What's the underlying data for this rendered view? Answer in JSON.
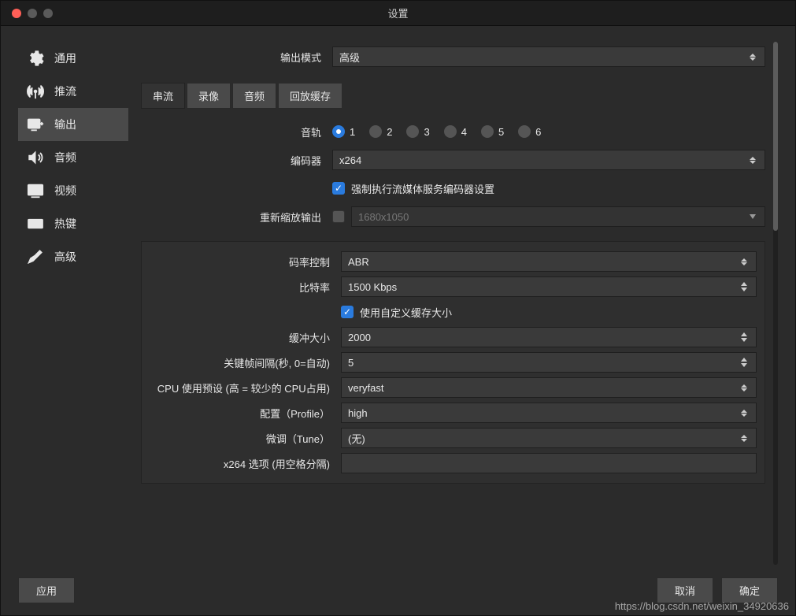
{
  "window": {
    "title": "设置"
  },
  "sidebar": {
    "items": [
      {
        "label": "通用"
      },
      {
        "label": "推流"
      },
      {
        "label": "输出"
      },
      {
        "label": "音频"
      },
      {
        "label": "视频"
      },
      {
        "label": "热键"
      },
      {
        "label": "高级"
      }
    ]
  },
  "output_mode": {
    "label": "输出模式",
    "value": "高级"
  },
  "tabs": {
    "items": [
      "串流",
      "录像",
      "音频",
      "回放缓存"
    ]
  },
  "tracks": {
    "label": "音轨",
    "options": [
      "1",
      "2",
      "3",
      "4",
      "5",
      "6"
    ],
    "selected": "1"
  },
  "encoder": {
    "label": "编码器",
    "value": "x264"
  },
  "enforce": {
    "label": "强制执行流媒体服务编码器设置",
    "checked": true
  },
  "rescale": {
    "label": "重新缩放输出",
    "checked": false,
    "value": "1680x1050"
  },
  "rate_control": {
    "label": "码率控制",
    "value": "ABR"
  },
  "bitrate": {
    "label": "比特率",
    "value": "1500 Kbps"
  },
  "custom_buffer": {
    "label": "使用自定义缓存大小",
    "checked": true
  },
  "buffer_size": {
    "label": "缓冲大小",
    "value": "2000"
  },
  "keyframe": {
    "label": "关键帧间隔(秒, 0=自动)",
    "value": "5"
  },
  "cpu_preset": {
    "label": "CPU 使用预设 (高 = 较少的 CPU占用)",
    "value": "veryfast"
  },
  "profile": {
    "label": "配置（Profile）",
    "value": "high"
  },
  "tune": {
    "label": "微调（Tune）",
    "value": "(无)"
  },
  "x264opts": {
    "label": "x264 选项 (用空格分隔)",
    "value": ""
  },
  "footer": {
    "apply": "应用",
    "cancel": "取消",
    "ok": "确定"
  },
  "watermark": "https://blog.csdn.net/weixin_34920636"
}
